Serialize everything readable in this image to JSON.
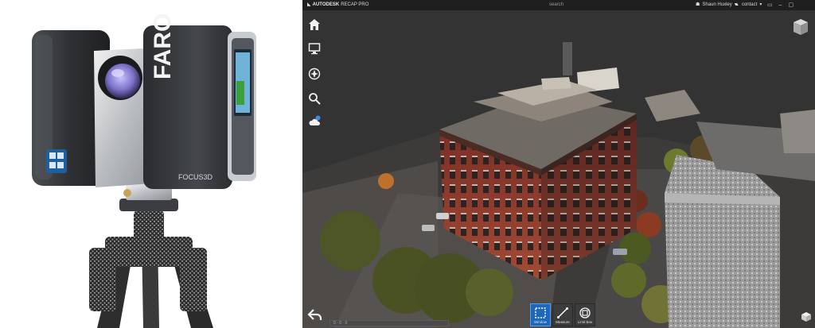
{
  "app": {
    "brand": "AUTODESK",
    "product": "RECAP PRO",
    "search_placeholder": "search",
    "user_name": "Shaun Huxley",
    "account_label": "contact"
  },
  "left_tools": [
    {
      "name": "home-icon"
    },
    {
      "name": "display-settings-icon"
    },
    {
      "name": "navigation-icon"
    },
    {
      "name": "search-icon"
    },
    {
      "name": "cloud-icon"
    }
  ],
  "bottom_tools": [
    {
      "label": "Window",
      "icon": "selection-window-icon",
      "active": true
    },
    {
      "label": "Measure",
      "icon": "measure-icon",
      "active": false
    },
    {
      "label": "Limit Box",
      "icon": "limit-box-icon",
      "active": false
    }
  ],
  "status": {
    "strip_text": "0  ·  0  ·  0"
  },
  "product_photo": {
    "brand_text": "FARO",
    "model_text": "FOCUS3D"
  },
  "colors": {
    "viewer_bg": "#333333",
    "topbar_bg": "#1f1f1f",
    "active_tool": "#1f68b8",
    "brick": "#8b3a2c"
  }
}
